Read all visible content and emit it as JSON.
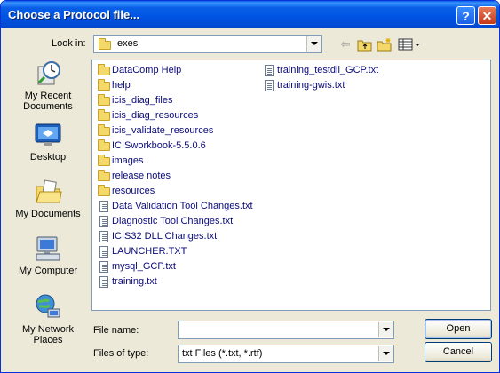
{
  "window": {
    "title": "Choose a Protocol file...",
    "help_glyph": "?",
    "close_glyph": "✕"
  },
  "lookin": {
    "label": "Look in:",
    "value": "exes"
  },
  "places": [
    {
      "label": "My Recent Documents",
      "icon": "recent-documents-icon"
    },
    {
      "label": "Desktop",
      "icon": "desktop-icon"
    },
    {
      "label": "My Documents",
      "icon": "my-documents-icon"
    },
    {
      "label": "My Computer",
      "icon": "my-computer-icon"
    },
    {
      "label": "My Network Places",
      "icon": "network-places-icon"
    }
  ],
  "files": {
    "col1": [
      {
        "name": "DataComp Help",
        "type": "folder"
      },
      {
        "name": "help",
        "type": "folder"
      },
      {
        "name": "icis_diag_files",
        "type": "folder"
      },
      {
        "name": "icis_diag_resources",
        "type": "folder"
      },
      {
        "name": "icis_validate_resources",
        "type": "folder"
      },
      {
        "name": "ICISworkbook-5.5.0.6",
        "type": "folder"
      },
      {
        "name": "images",
        "type": "folder"
      },
      {
        "name": "release notes",
        "type": "folder"
      },
      {
        "name": "resources",
        "type": "folder"
      },
      {
        "name": "Data Validation Tool Changes.txt",
        "type": "file"
      },
      {
        "name": "Diagnostic Tool Changes.txt",
        "type": "file"
      },
      {
        "name": "ICIS32 DLL Changes.txt",
        "type": "file"
      },
      {
        "name": "LAUNCHER.TXT",
        "type": "file"
      },
      {
        "name": "mysql_GCP.txt",
        "type": "file"
      },
      {
        "name": "training.txt",
        "type": "file"
      }
    ],
    "col2": [
      {
        "name": "training_testdll_GCP.txt",
        "type": "file"
      },
      {
        "name": "training-gwis.txt",
        "type": "file"
      }
    ]
  },
  "filename": {
    "label": "File name:",
    "value": ""
  },
  "filetype": {
    "label": "Files of type:",
    "value": "txt Files (*.txt, *.rtf)"
  },
  "buttons": {
    "open": "Open",
    "cancel": "Cancel"
  }
}
